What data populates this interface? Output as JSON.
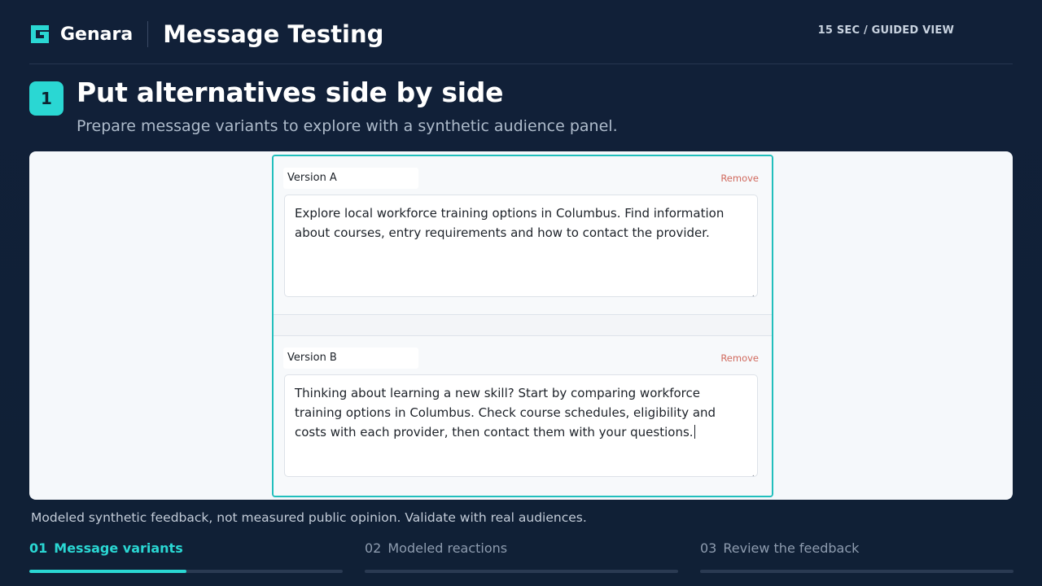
{
  "header": {
    "brand": "Genara",
    "app_title": "Message Testing",
    "guided_view": "15 SEC / GUIDED VIEW"
  },
  "step": {
    "number": "1",
    "title": "Put alternatives side by side",
    "subtitle": "Prepare message variants to explore with a synthetic audience panel."
  },
  "variants": [
    {
      "name": "Version A",
      "remove_label": "Remove",
      "text": "Explore local workforce training options in Columbus. Find information about courses, entry requirements and how to contact the provider."
    },
    {
      "name": "Version B",
      "remove_label": "Remove",
      "text": "Thinking about learning a new skill? Start by comparing workforce training options in Columbus. Check course schedules, eligibility and costs with each provider, then contact them with your questions."
    }
  ],
  "disclaimer": "Modeled synthetic feedback, not measured public opinion. Validate with real audiences.",
  "steps_nav": [
    {
      "num": "01",
      "label": "Message variants",
      "active": true,
      "progress": 0.5
    },
    {
      "num": "02",
      "label": "Modeled reactions",
      "active": false,
      "progress": 0
    },
    {
      "num": "03",
      "label": "Review the feedback",
      "active": false,
      "progress": 0
    }
  ],
  "colors": {
    "accent": "#2ad7d3",
    "background": "#11203a",
    "remove": "#d16a5e"
  },
  "icons": {
    "logo": "genara-logo-icon",
    "resize": "resize-grip-icon"
  }
}
